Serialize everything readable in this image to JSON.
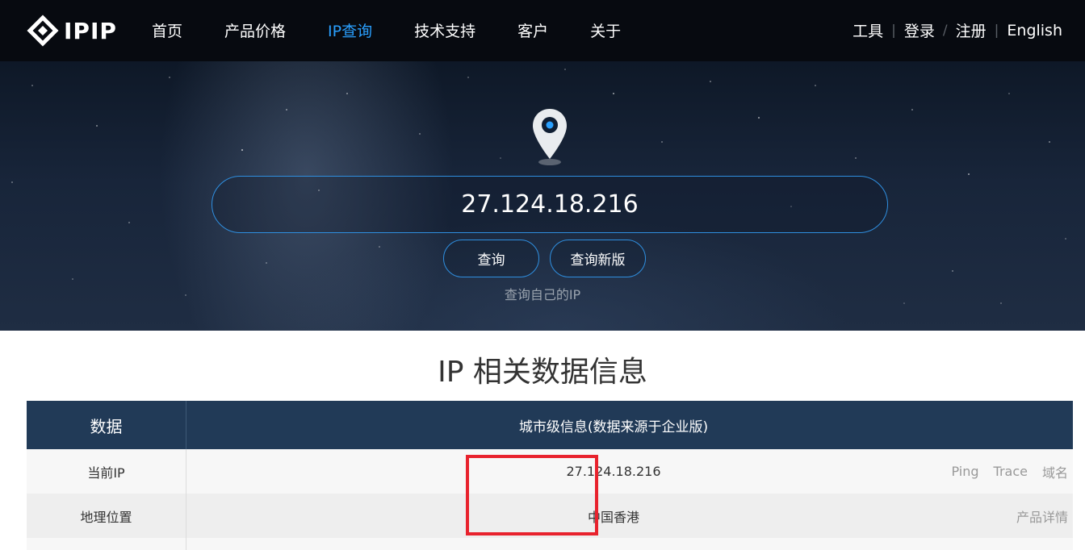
{
  "header": {
    "logo_text": "IPIP",
    "nav": [
      {
        "label": "首页",
        "active": false
      },
      {
        "label": "产品价格",
        "active": false
      },
      {
        "label": "IP查询",
        "active": true
      },
      {
        "label": "技术支持",
        "active": false
      },
      {
        "label": "客户",
        "active": false
      },
      {
        "label": "关于",
        "active": false
      }
    ],
    "right": {
      "tools": "工具",
      "login": "登录",
      "register": "注册",
      "english": "English",
      "sep_bar": "|",
      "sep_slash": "/"
    }
  },
  "hero": {
    "search_value": "27.124.18.216",
    "query_button": "查询",
    "query_new_button": "查询新版",
    "my_ip_link": "查询自己的IP"
  },
  "content": {
    "title": "IP 相关数据信息",
    "table": {
      "header": [
        "数据",
        "城市级信息(数据来源于企业版)"
      ],
      "rows": [
        {
          "label": "当前IP",
          "value": "27.124.18.216",
          "links": [
            "Ping",
            "Trace",
            "域名"
          ]
        },
        {
          "label": "地理位置",
          "value": "中国香港",
          "links": [
            "产品详情"
          ]
        }
      ]
    }
  },
  "colors": {
    "accent": "#2aa0ff",
    "table_header": "#213a57",
    "highlight": "#e8222d"
  }
}
